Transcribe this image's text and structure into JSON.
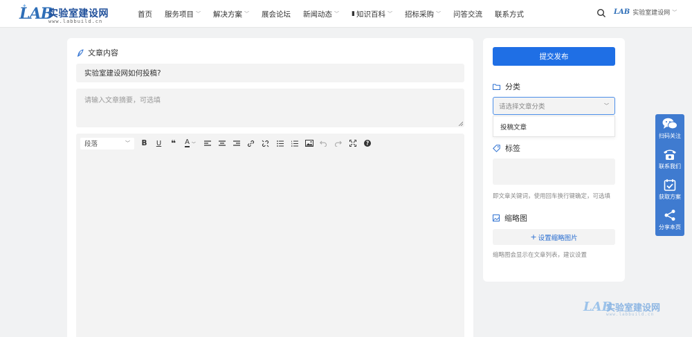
{
  "header": {
    "logo": {
      "lab": "LAB",
      "name": "实验室建设网",
      "url": "www.labbuild.cn"
    },
    "nav": [
      {
        "label": "首页",
        "has_dropdown": false
      },
      {
        "label": "服务项目",
        "has_dropdown": true
      },
      {
        "label": "解决方案",
        "has_dropdown": true
      },
      {
        "label": "展会论坛",
        "has_dropdown": false
      },
      {
        "label": "新闻动态",
        "has_dropdown": true
      },
      {
        "label": "知识百科",
        "has_dropdown": true,
        "icon": "book-icon"
      },
      {
        "label": "招标采购",
        "has_dropdown": true
      },
      {
        "label": "问答交流",
        "has_dropdown": false
      },
      {
        "label": "联系方式",
        "has_dropdown": false
      }
    ],
    "site_switch_label": "实验室建设网"
  },
  "article": {
    "section_title": "文章内容",
    "title_value": "实验室建设网如何投稿?",
    "summary_placeholder": "请输入文章摘要，可选填",
    "paragraph_select": "段落"
  },
  "sidebar": {
    "publish_label": "提交发布",
    "category": {
      "title": "分类",
      "placeholder": "请选择文章分类",
      "options": [
        "投稿文章"
      ]
    },
    "tags": {
      "title": "标签",
      "hint": "即文章关键词，使用回车换行键确定，可选填"
    },
    "thumbnail": {
      "title": "缩略图",
      "button_label": "设置缩略图片",
      "hint": "缩略图会显示在文章列表，建议设置"
    }
  },
  "float_bar": [
    {
      "label": "扫码关注",
      "icon": "wechat-icon"
    },
    {
      "label": "联系我们",
      "icon": "phone-icon"
    },
    {
      "label": "获取方案",
      "icon": "calendar-check-icon"
    },
    {
      "label": "分享本页",
      "icon": "share-icon"
    }
  ],
  "colors": {
    "accent": "#1f6fe5",
    "float_bar": "#3f7bd0",
    "background": "#f1f2f3"
  }
}
